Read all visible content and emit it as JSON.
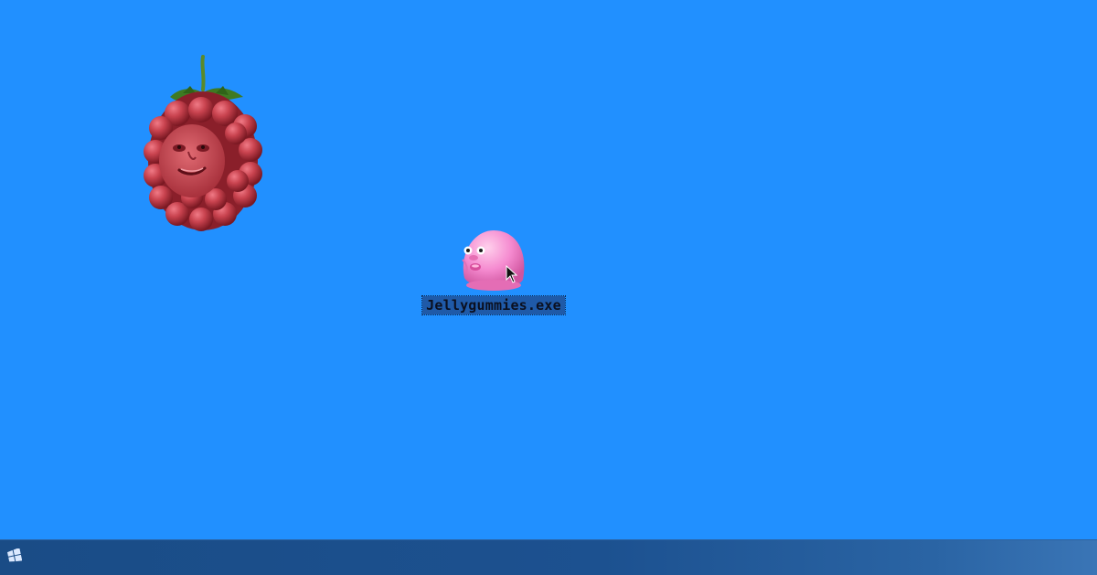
{
  "desktop": {
    "background_color": "#2190ff",
    "art": {
      "icon": "raspberry-face-icon"
    },
    "icons": [
      {
        "label": "Jellygummies.exe",
        "icon": "pink-gummy-face-icon",
        "selected": true
      }
    ]
  },
  "taskbar": {
    "start_icon": "windows-logo-icon"
  }
}
